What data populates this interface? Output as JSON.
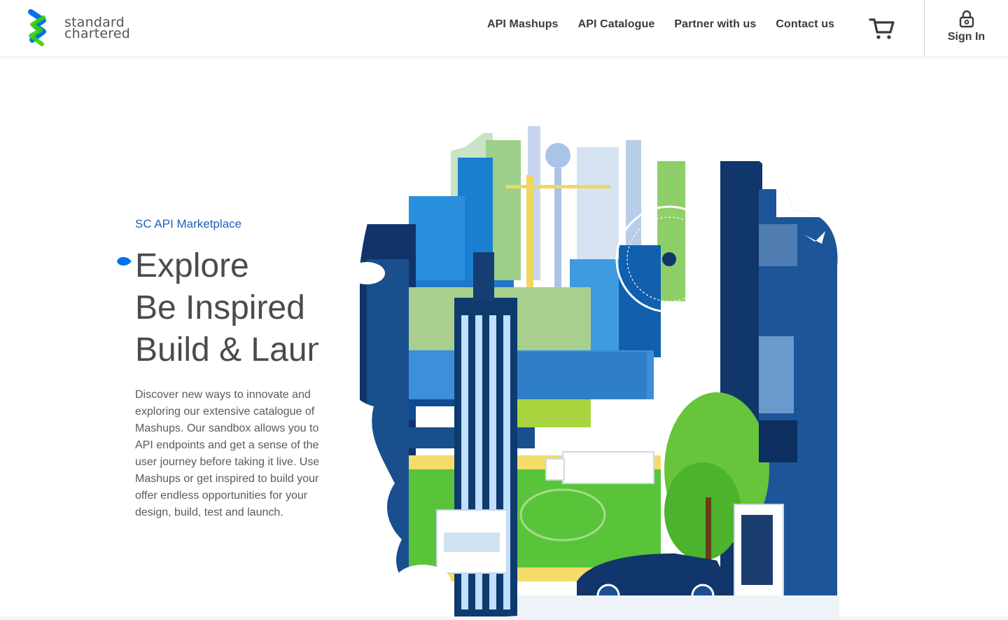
{
  "brand": {
    "name_line1": "standard",
    "name_line2": "chartered",
    "colors": {
      "blue": "#0473ea",
      "green": "#38d200",
      "text": "#525355",
      "accent": "#1b62b4"
    }
  },
  "nav": {
    "items": [
      {
        "label": "API Mashups"
      },
      {
        "label": "API Catalogue"
      },
      {
        "label": "Partner with us"
      },
      {
        "label": "Contact us"
      }
    ],
    "cart_icon": "cart-icon",
    "signin_icon": "lock-icon",
    "signin_label": "Sign In"
  },
  "hero": {
    "eyebrow": "SC API Marketplace",
    "headline": [
      "Explore",
      "Be Inspired",
      "Build & Launch"
    ],
    "description": [
      "Discover new ways to innovate and",
      "exploring our extensive catalogue of",
      "Mashups. Our sandbox allows you to",
      "API endpoints and get a sense of the",
      "user journey before taking it live. Use",
      "Mashups or get inspired to build your",
      "offer endless opportunities for your",
      "design, build, test and launch."
    ]
  }
}
